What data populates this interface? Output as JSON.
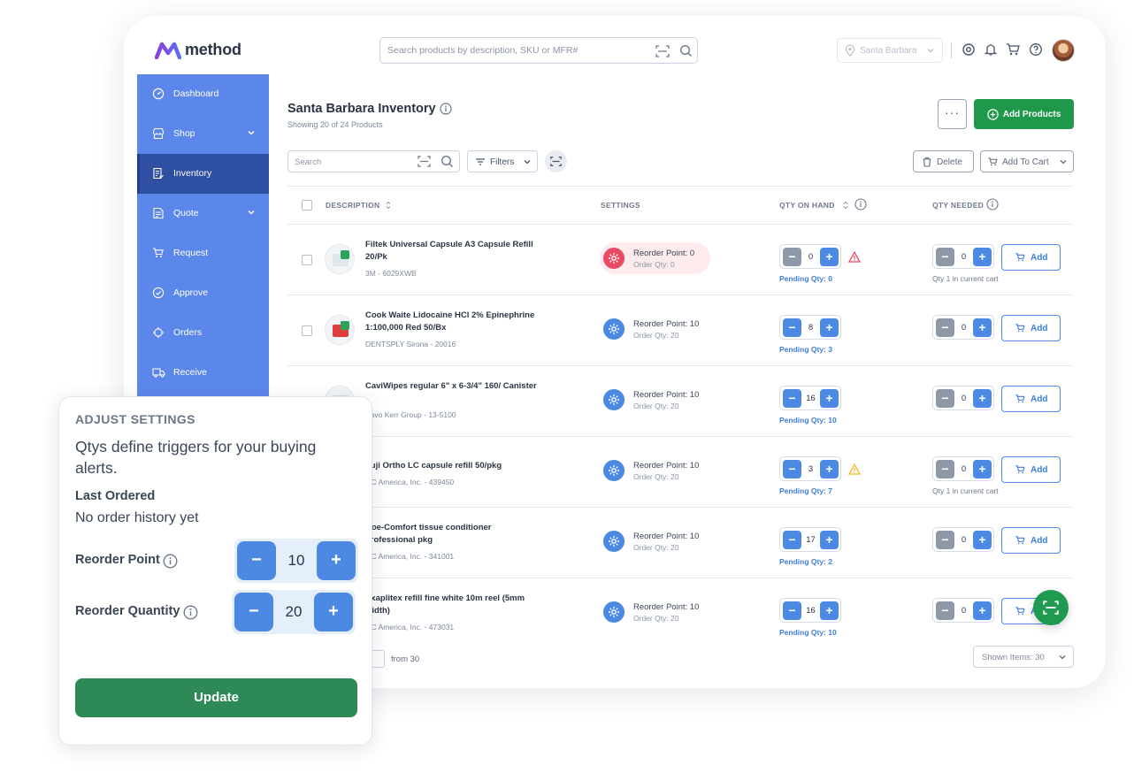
{
  "app": {
    "brand": "method",
    "search_placeholder": "Search products by description, SKU or MFR#",
    "location": "Santa Barbara"
  },
  "colors": {
    "sidebar": "#5b87ea",
    "sidebar_active": "#2f4fa3",
    "primary_blue": "#4b89e3",
    "success_green": "#20984b",
    "update_green": "#2d8a57",
    "alert_red": "#e84a64",
    "warning_yellow": "#f2b824"
  },
  "sidebar": {
    "items": [
      {
        "label": "Dashboard",
        "icon": "dashboard-icon"
      },
      {
        "label": "Shop",
        "icon": "store-icon"
      },
      {
        "label": "Inventory",
        "icon": "inventory-icon"
      },
      {
        "label": "Quote",
        "icon": "quote-icon"
      },
      {
        "label": "Request",
        "icon": "cart-icon"
      },
      {
        "label": "Approve",
        "icon": "check-circle-icon"
      },
      {
        "label": "Orders",
        "icon": "orders-icon"
      },
      {
        "label": "Receive",
        "icon": "truck-icon"
      }
    ]
  },
  "page": {
    "title": "Santa Barbara Inventory",
    "subtitle": "Showing 20 of 24 Products",
    "add_products": "Add Products",
    "more": "···",
    "search_placeholder": "Search",
    "filters": "Filters",
    "delete": "Delete",
    "add_to_cart": "Add To Cart"
  },
  "table": {
    "headers": {
      "description": "DESCRIPTION",
      "settings": "SETTINGS",
      "qty_on_hand": "QTY ON HAND",
      "qty_needed": "QTY NEEDED"
    },
    "add_label": "Add",
    "rows": [
      {
        "name": "Filtek Universal Capsule A3 Capsule Refill 20/Pk",
        "meta": "3M - 6029XWB",
        "reorder_point": "Reorder Point: 0",
        "order_qty": "Order Qty: 0",
        "on_hand": "0",
        "pending": "Pending Qty: 0",
        "needed": "0",
        "cart_note": "Qty 1 in current cart"
      },
      {
        "name": "Cook Waite Lidocaine HCl 2% Epinephrine 1:100,000 Red 50/Bx",
        "meta": "DENTSPLY Sirona - 20016",
        "reorder_point": "Reorder Point: 10",
        "order_qty": "Order Qty: 20",
        "on_hand": "8",
        "pending": "Pending Qty: 3",
        "needed": "0",
        "cart_note": ""
      },
      {
        "name": "CaviWipes regular 6\" x 6-3/4\" 160/ Canister",
        "meta": "Kavo Kerr Group - 13-5100",
        "reorder_point": "Reorder Point: 10",
        "order_qty": "Order Qty: 20",
        "on_hand": "16",
        "pending": "Pending Qty: 10",
        "needed": "0",
        "cart_note": ""
      },
      {
        "name": "Fuji Ortho LC capsule refill 50/pkg",
        "meta": "GC America, Inc. - 439450",
        "reorder_point": "Reorder Point: 10",
        "order_qty": "Order Qty: 20",
        "on_hand": "3",
        "pending": "Pending Qty: 7",
        "needed": "0",
        "cart_note": "Qty 1 in current cart"
      },
      {
        "name": "Coe-Comfort tissue conditioner professional pkg",
        "meta": "GC America, Inc. - 341001",
        "reorder_point": "Reorder Point: 10",
        "order_qty": "Order Qty: 20",
        "on_hand": "17",
        "pending": "Pending Qty: 2",
        "needed": "0",
        "cart_note": ""
      },
      {
        "name": "Exaplitex refill fine white 10m reel (5mm width)",
        "meta": "GC America, Inc. - 473031",
        "reorder_point": "Reorder Point: 10",
        "order_qty": "Order Qty: 20",
        "on_hand": "16",
        "pending": "Pending Qty: 10",
        "needed": "0",
        "cart_note": ""
      }
    ]
  },
  "pagination": {
    "from": "from 30",
    "shown": "Shown Items: 30"
  },
  "adjust": {
    "title": "ADJUST SETTINGS",
    "description": "Qtys define triggers for your buying alerts.",
    "last_ordered_label": "Last Ordered",
    "last_ordered_value": "No order history yet",
    "reorder_point_label": "Reorder Point",
    "reorder_point_value": "10",
    "reorder_qty_label": "Reorder Quantity",
    "reorder_qty_value": "20",
    "minus": "−",
    "plus": "+",
    "update": "Update"
  }
}
